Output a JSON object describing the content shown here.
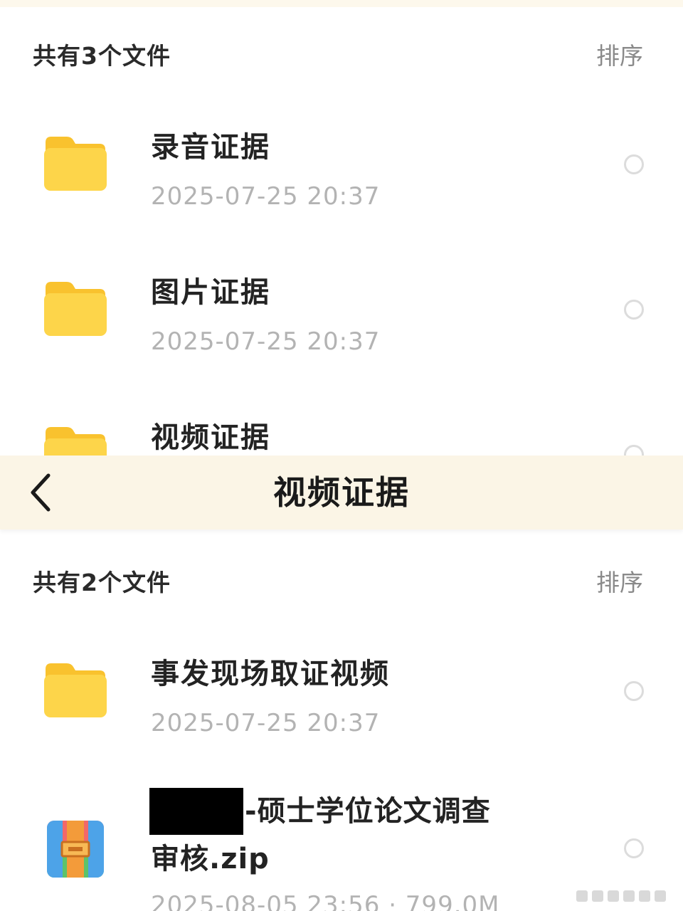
{
  "top_panel": {
    "count_label": "共有3个文件",
    "sort_label": "排序",
    "files": [
      {
        "name": "录音证据",
        "meta": "2025-07-25 20:37",
        "icon": "folder-icon"
      },
      {
        "name": "图片证据",
        "meta": "2025-07-25 20:37",
        "icon": "folder-icon"
      },
      {
        "name": "视频证据",
        "meta": "",
        "icon": "folder-icon"
      }
    ]
  },
  "bottom_panel": {
    "header": {
      "title": "视频证据",
      "back_icon": "chevron-left-icon"
    },
    "count_label": "共有2个文件",
    "sort_label": "排序",
    "files": [
      {
        "name": "事发现场取证视频",
        "meta": "2025-07-25 20:37",
        "icon": "folder-icon"
      },
      {
        "name_line1": "-硕士学位论文调查",
        "name_line2": "审核.zip",
        "meta": "2025-08-05 23:56 · 799.0M",
        "icon": "zip-archive-icon"
      }
    ]
  },
  "colors": {
    "folder_yellow": "#FDD54A",
    "folder_tab": "#F9C22E",
    "header_bg": "#FBF5E6",
    "meta_gray": "#B3B3B3"
  }
}
